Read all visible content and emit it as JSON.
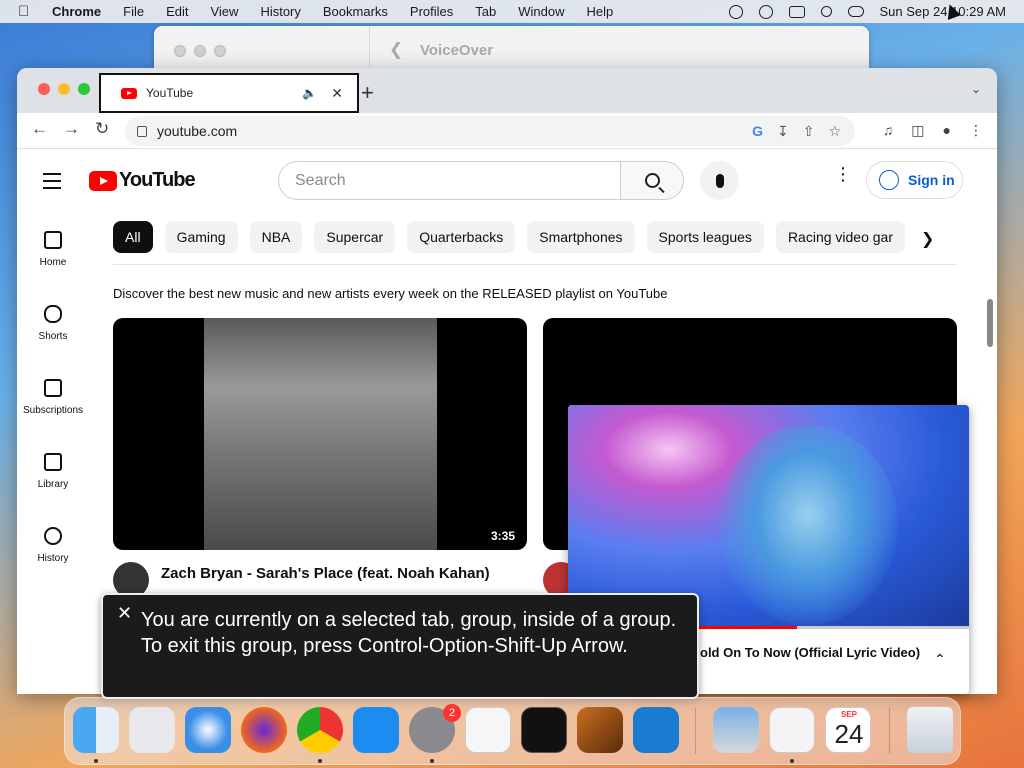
{
  "menubar": {
    "app_name": "Chrome",
    "items": [
      "File",
      "Edit",
      "View",
      "History",
      "Bookmarks",
      "Profiles",
      "Tab",
      "Window",
      "Help"
    ],
    "clock": "Sun Sep 24 10:29 AM"
  },
  "voiceover_window": {
    "title": "VoiceOver"
  },
  "browser": {
    "tab_title": "YouTube",
    "url": "youtube.com"
  },
  "youtube": {
    "logo_text": "YouTube",
    "search_placeholder": "Search",
    "signin_label": "Sign in",
    "sidebar": [
      {
        "label": "Home",
        "icon": "home-icon"
      },
      {
        "label": "Shorts",
        "icon": "shorts-icon"
      },
      {
        "label": "Subscriptions",
        "icon": "subscriptions-icon"
      },
      {
        "label": "Library",
        "icon": "library-icon"
      },
      {
        "label": "History",
        "icon": "history-icon"
      }
    ],
    "chips": [
      "All",
      "Gaming",
      "NBA",
      "Supercar",
      "Quarterbacks",
      "Smartphones",
      "Sports leagues",
      "Racing video gar"
    ],
    "promo_text": "Discover the best new music and new artists every week on the RELEASED playlist on YouTube",
    "video1": {
      "title": "Zach Bryan - Sarah's Place (feat. Noah Kahan)",
      "duration": "3:35"
    },
    "pip": {
      "title": "old On To Now (Official Lyric Video)",
      "progress": 0.57
    }
  },
  "voiceover_caption": {
    "text": "You are currently on a selected tab, group, inside of a group.  To exit this group, press Control-Option-Shift-Up Arrow."
  },
  "dock": {
    "apps": [
      "finder",
      "launchpad",
      "safari",
      "firefox",
      "chrome",
      "app-store",
      "system-settings",
      "textedit",
      "terminal",
      "garageband",
      "vscode",
      "preview",
      "freeform",
      "calendar",
      "trash"
    ],
    "settings_badge": "2",
    "calendar_month": "SEP",
    "calendar_day": "24"
  },
  "colors": {
    "youtube_red": "#ff0000",
    "link_blue": "#065fd4"
  }
}
